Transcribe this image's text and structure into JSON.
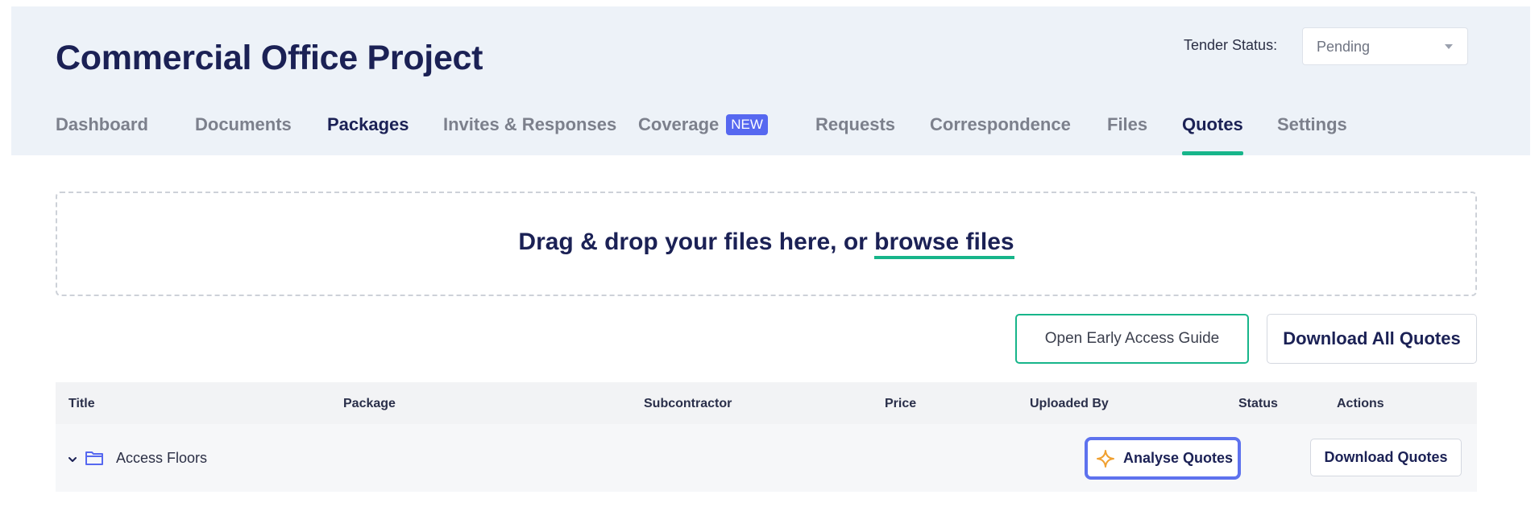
{
  "project": {
    "title": "Commercial Office Project"
  },
  "tender": {
    "label": "Tender Status:",
    "value": "Pending"
  },
  "tabs": [
    {
      "label": "Dashboard"
    },
    {
      "label": "Documents"
    },
    {
      "label": "Packages"
    },
    {
      "label": "Invites & Responses"
    },
    {
      "label": "Coverage",
      "badge": "NEW"
    },
    {
      "label": "Requests"
    },
    {
      "label": "Correspondence"
    },
    {
      "label": "Files"
    },
    {
      "label": "Quotes",
      "active": true
    },
    {
      "label": "Settings"
    }
  ],
  "dropzone": {
    "text": "Drag & drop your files here, or ",
    "link": "browse files"
  },
  "actions": {
    "guide": "Open Early Access Guide",
    "download_all": "Download All Quotes"
  },
  "table": {
    "columns": [
      "Title",
      "Package",
      "Subcontractor",
      "Price",
      "Uploaded By",
      "Status",
      "Actions"
    ],
    "rows": [
      {
        "title": "Access Floors",
        "analyse_label": "Analyse Quotes",
        "download_label": "Download Quotes"
      }
    ]
  },
  "colors": {
    "accent": "#17b58a",
    "brand": "#1b2155",
    "highlight": "#5e72ee",
    "badge": "#5668f0",
    "spark": "#f0a030"
  },
  "icons": {
    "expand": "chevron-down-icon",
    "folder": "folder-icon",
    "analyse": "sparkle-icon",
    "tender_select": "caret-down-icon"
  }
}
